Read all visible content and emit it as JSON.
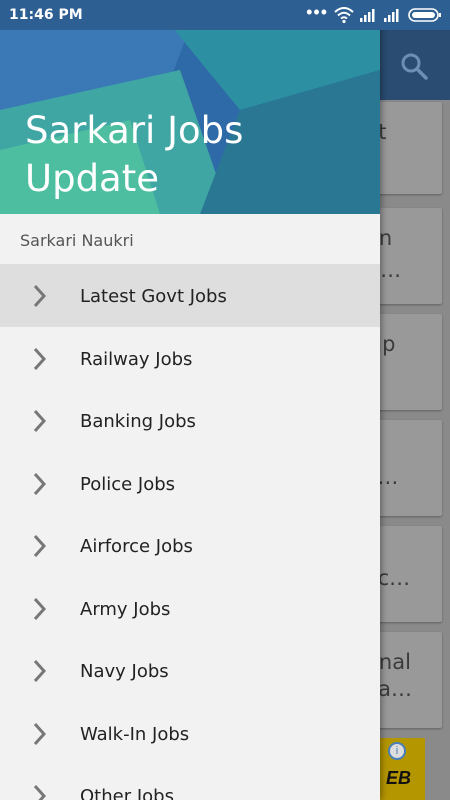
{
  "status_bar": {
    "time": "11:46 PM",
    "icons": [
      "more-dots-icon",
      "wifi-icon",
      "signal-icon",
      "signal-icon-2",
      "battery-icon"
    ]
  },
  "drawer": {
    "header_title_line1": "Sarkari Jobs",
    "header_title_line2": "Update",
    "section_label": "Sarkari Naukri",
    "items": [
      {
        "label": "Latest Govt Jobs",
        "icon": "chevron-right-icon",
        "active": true
      },
      {
        "label": "Railway Jobs",
        "icon": "chevron-right-icon"
      },
      {
        "label": "Banking Jobs",
        "icon": "chevron-right-icon"
      },
      {
        "label": "Police Jobs",
        "icon": "chevron-right-icon"
      },
      {
        "label": "Airforce Jobs",
        "icon": "chevron-right-icon"
      },
      {
        "label": "Army Jobs",
        "icon": "chevron-right-icon"
      },
      {
        "label": "Navy Jobs",
        "icon": "chevron-right-icon"
      },
      {
        "label": "Walk-In Jobs",
        "icon": "chevron-right-icon"
      },
      {
        "label": "Other Jobs",
        "icon": "chevron-right-icon"
      }
    ]
  },
  "background": {
    "search_icon": "search-icon",
    "cards": [
      {
        "line1": "ent",
        "line2": ""
      },
      {
        "line1": "tion",
        "line2": "or …"
      },
      {
        "line1": "ship",
        "line2": ""
      },
      {
        "line1": "t",
        "line2": "al …"
      },
      {
        "line1": "",
        "line2": "Vac…"
      },
      {
        "line1": "tional",
        "line2": "ana…"
      }
    ],
    "ad_text": "EB"
  },
  "colors": {
    "status_bar": "#2d5f93",
    "header_bg": "#2f6aa8",
    "header_accent": "#4dbfa0",
    "active_row": "#dedede",
    "drawer_bg": "#f2f2f2"
  }
}
